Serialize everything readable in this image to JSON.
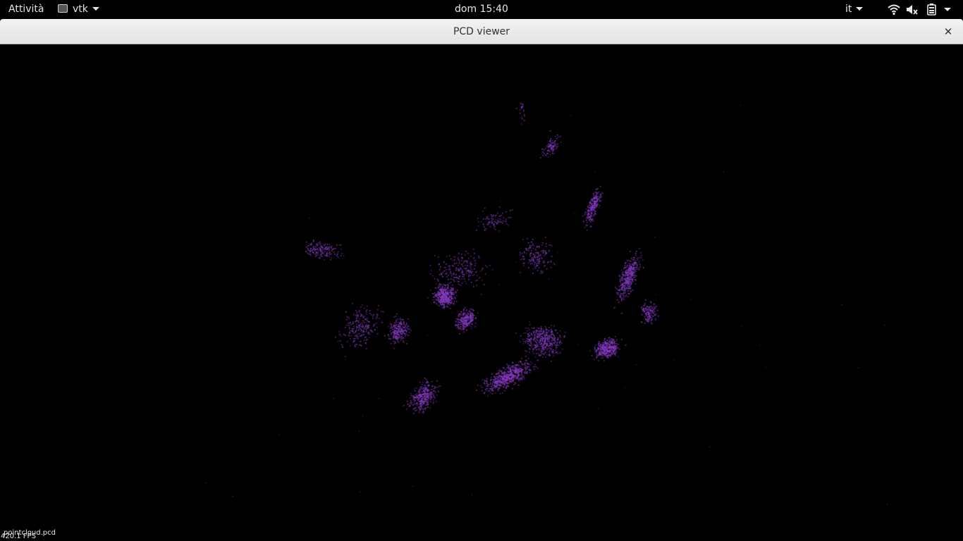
{
  "topbar": {
    "activities_label": "Attività",
    "app_name": "vtk",
    "clock": "dom 15:40",
    "keyboard_layout": "it",
    "status_icons": [
      "wifi-icon",
      "volume-muted-icon",
      "battery-icon",
      "system-menu-caret"
    ]
  },
  "window": {
    "title": "PCD viewer",
    "close_label": "✕"
  },
  "viewer": {
    "background_color": "#000000",
    "point_color": "#8a3cc8",
    "fps_text": "420.1 FPS",
    "filename": "pointcloud.pcd"
  }
}
